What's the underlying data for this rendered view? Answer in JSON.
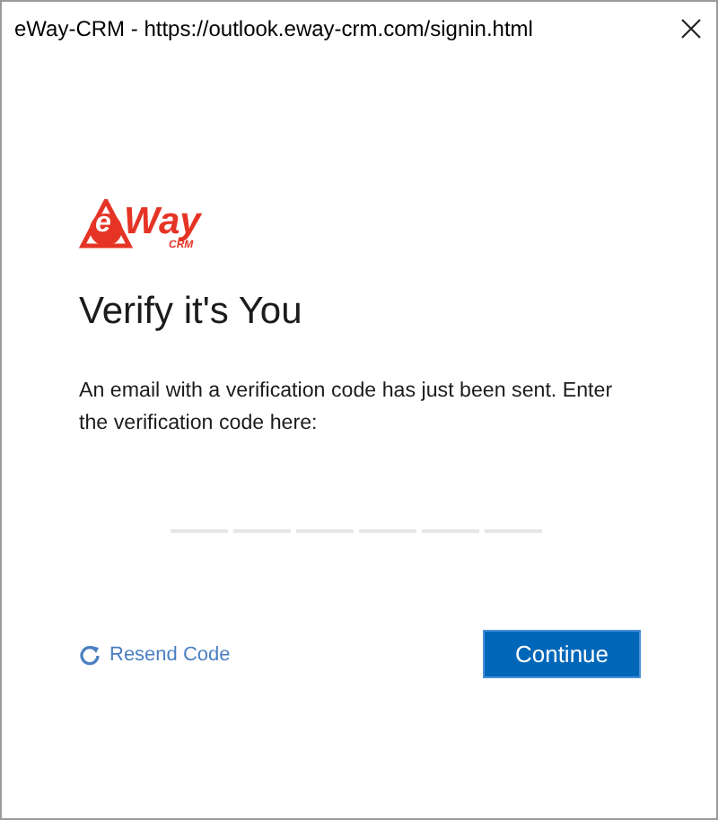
{
  "window": {
    "title": "eWay-CRM - https://outlook.eway-crm.com/signin.html"
  },
  "logo": {
    "letter": "e",
    "word": "Way",
    "sub": "CRM"
  },
  "heading": "Verify it's You",
  "message": "An email with a verification code has just been sent. Enter the verification code here:",
  "code_fields": [
    {
      "focused": false
    },
    {
      "focused": false
    },
    {
      "focused": false
    },
    {
      "focused": false
    },
    {
      "focused": false
    },
    {
      "focused": false
    }
  ],
  "resend_link": "Resend Code",
  "continue_button": "Continue"
}
